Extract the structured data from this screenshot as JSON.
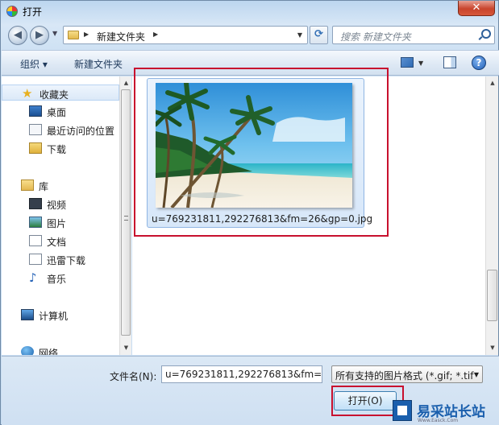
{
  "window": {
    "title": "打开",
    "close_label": "✕"
  },
  "address_bar": {
    "back_icon": "back-arrow-icon",
    "forward_icon": "forward-arrow-icon",
    "path": [
      "新建文件夹"
    ],
    "refresh_icon": "refresh-icon"
  },
  "search": {
    "placeholder": "搜索 新建文件夹"
  },
  "toolbar": {
    "organize_label": "组织 ▾",
    "new_folder_label": "新建文件夹",
    "help_label": "?"
  },
  "navigation": {
    "favorites": {
      "label": "收藏夹",
      "items": [
        {
          "label": "桌面"
        },
        {
          "label": "最近访问的位置"
        },
        {
          "label": "下载"
        }
      ]
    },
    "libraries": {
      "label": "库",
      "items": [
        {
          "label": "视频"
        },
        {
          "label": "图片"
        },
        {
          "label": "文档"
        },
        {
          "label": "迅雷下载"
        },
        {
          "label": "音乐"
        }
      ]
    },
    "computer": {
      "label": "计算机"
    },
    "network": {
      "label": "网络"
    }
  },
  "files": [
    {
      "name": "u=769231811,292276813&fm=26&gp=0.jpg",
      "selected": true
    }
  ],
  "bottom": {
    "file_name_label": "文件名(N):",
    "file_name_value": "u=769231811,292276813&fm=",
    "file_type_value": "所有支持的图片格式 (*.gif; *.tif",
    "open_label": "打开(O)"
  },
  "watermark": {
    "text": "易采站长站",
    "url": "Www.Easck.Com"
  },
  "colors": {
    "highlight": "#c8102e",
    "accent": "#1a5fad"
  }
}
